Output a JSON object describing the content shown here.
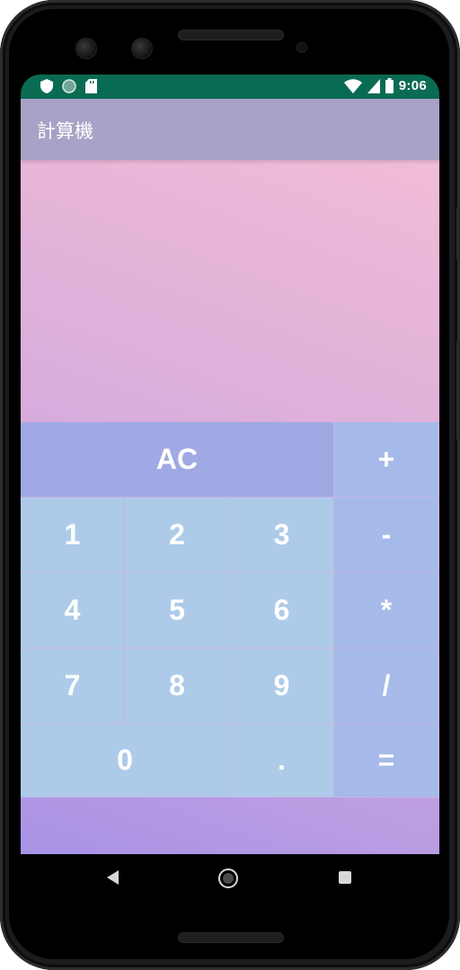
{
  "status_bar": {
    "time": "9:06",
    "left_icons": [
      "shield-icon",
      "circle-notification-icon",
      "sd-card-icon"
    ],
    "right_icons": [
      "wifi-icon",
      "cell-signal-icon",
      "battery-icon"
    ],
    "color": "#0a6b53"
  },
  "app_bar": {
    "title": "計算機",
    "color": "#a8a2c6"
  },
  "display": {
    "value": ""
  },
  "keypad": {
    "ac": "AC",
    "plus": "+",
    "minus": "-",
    "multiply": "*",
    "divide": "/",
    "equals": "=",
    "one": "1",
    "two": "2",
    "three": "3",
    "four": "4",
    "five": "5",
    "six": "6",
    "seven": "7",
    "eight": "8",
    "nine": "9",
    "zero": "0",
    "dot": "."
  },
  "navigation": {
    "icons": [
      "back-icon",
      "home-icon",
      "recents-icon"
    ]
  },
  "colors": {
    "number_key": "#adcbe9",
    "operator_key": "#a6bae9",
    "ac_key": "#a0a9e3",
    "gradient_top": "#f1bcd6",
    "gradient_bottom": "#a893e6"
  }
}
